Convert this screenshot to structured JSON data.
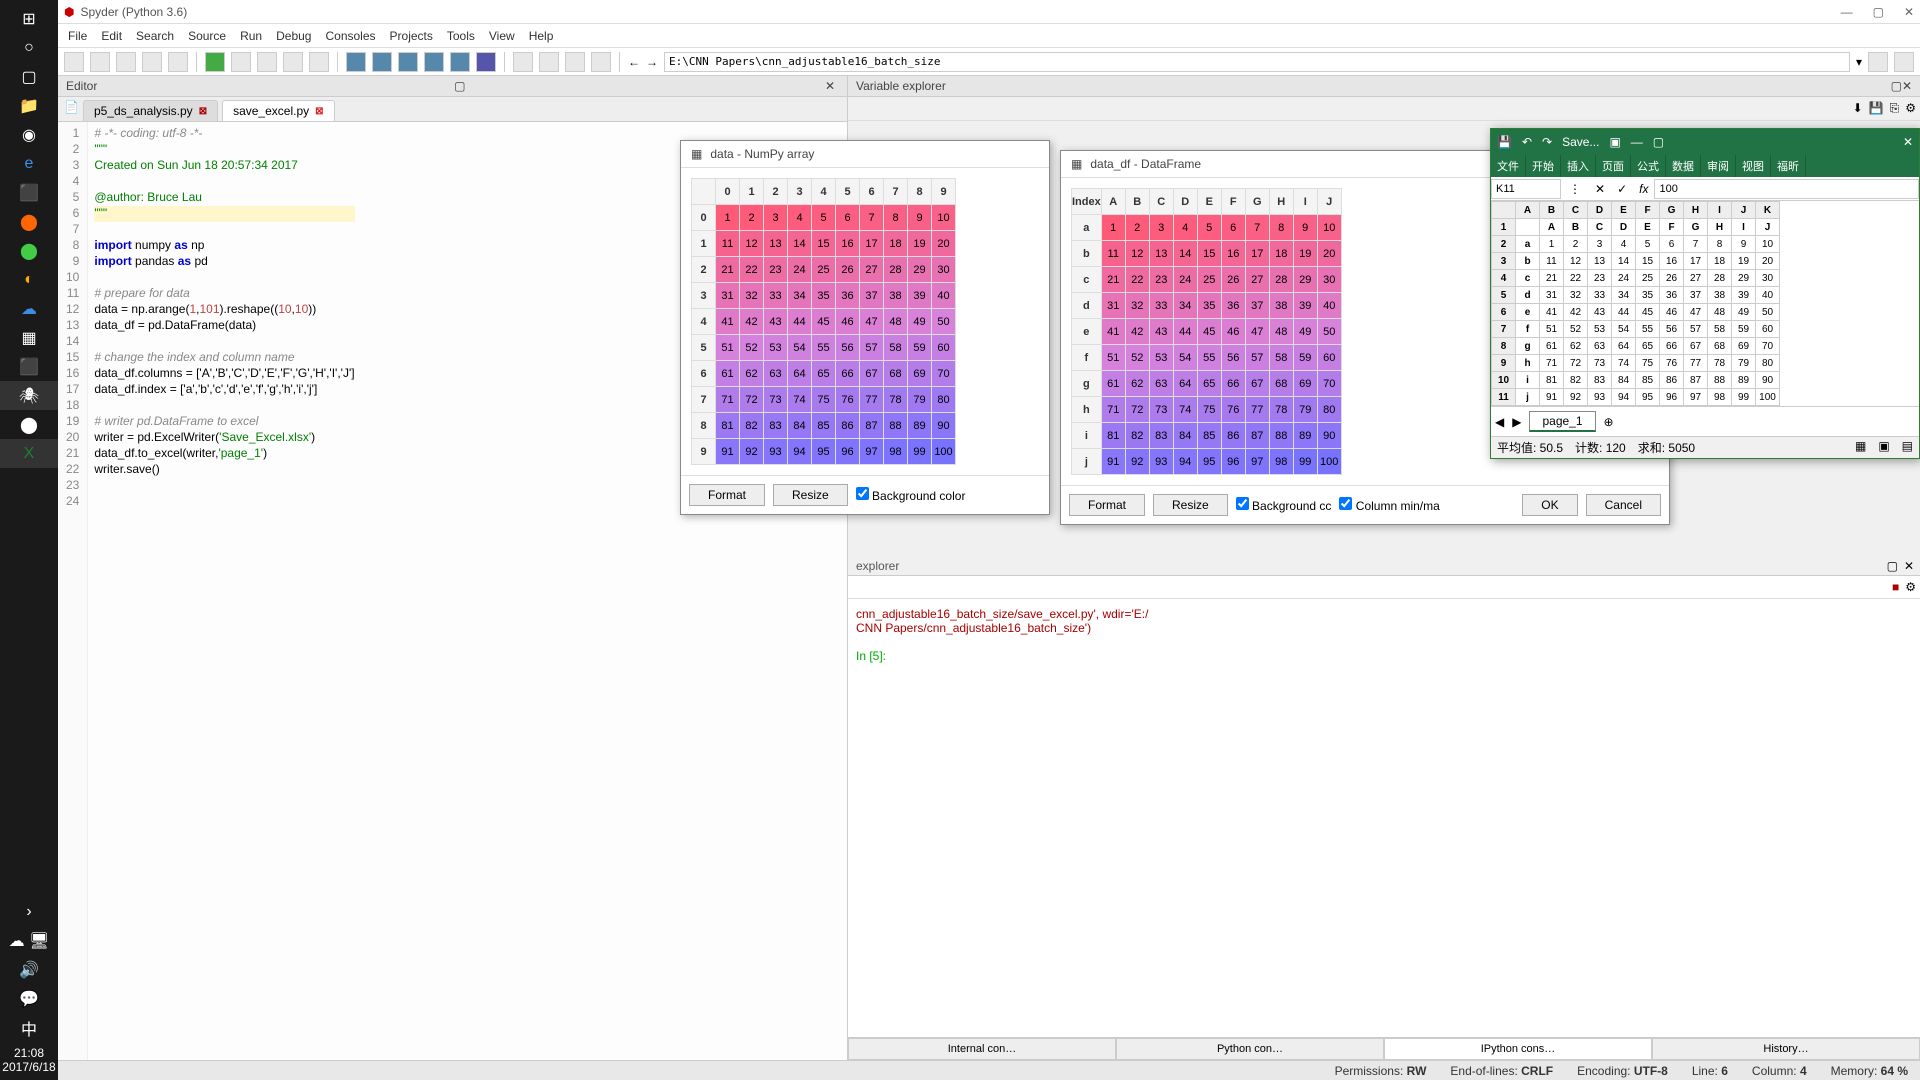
{
  "taskbar": {
    "clock_time": "21:08",
    "clock_date": "2017/6/18"
  },
  "title": "Spyder (Python 3.6)",
  "menus": [
    "File",
    "Edit",
    "Search",
    "Source",
    "Run",
    "Debug",
    "Consoles",
    "Projects",
    "Tools",
    "View",
    "Help"
  ],
  "path": "E:\\CNN Papers\\cnn_adjustable16_batch_size",
  "editor": {
    "pane": "Editor",
    "tabs": [
      {
        "label": "p5_ds_analysis.py",
        "dirty": true
      },
      {
        "label": "save_excel.py",
        "dirty": true,
        "active": true
      }
    ],
    "gutter": [
      "1",
      "2",
      "3",
      "4",
      "5",
      "6",
      "7",
      "8",
      "9",
      "10",
      "11",
      "12",
      "13",
      "14",
      "15",
      "16",
      "17",
      "18",
      "19",
      "20",
      "21",
      "22",
      "23",
      "24"
    ],
    "code": {
      "l1": "# -*- coding: utf-8 -*-",
      "l2": "\"\"\"",
      "l3": "Created on Sun Jun 18 20:57:34 2017",
      "l5": "@author: Bruce Lau",
      "l6": "\"\"\"",
      "l8a": "import",
      "l8b": " numpy ",
      "l8c": "as",
      "l8d": " np",
      "l9a": "import",
      "l9b": " pandas ",
      "l9c": "as",
      "l9d": " pd",
      "l11": "# prepare for data",
      "l12a": "data = np.arange(",
      "l12b": "1",
      "l12c": ",",
      "l12d": "101",
      "l12e": ").reshape((",
      "l12f": "10",
      "l12g": ",",
      "l12h": "10",
      "l12i": "))",
      "l13": "data_df = pd.DataFrame(data)",
      "l15": "# change the index and column name",
      "l16": "data_df.columns = ['A','B','C','D','E','F','G','H','I','J']",
      "l17": "data_df.index = ['a','b','c','d','e','f','g','h','i','j']",
      "l19": "# writer pd.DataFrame to excel",
      "l20a": "writer = pd.ExcelWriter(",
      "l20b": "'Save_Excel.xlsx'",
      "l20c": ")",
      "l21a": "data_df.to_excel(writer,",
      "l21b": "'page_1'",
      "l21c": ")",
      "l22": "writer.save()"
    }
  },
  "varexp_pane": "Variable explorer",
  "varexp_sub": "explorer",
  "viewers": {
    "numpy": {
      "title": "data - NumPy array",
      "cols": [
        "0",
        "1",
        "2",
        "3",
        "4",
        "5",
        "6",
        "7",
        "8",
        "9"
      ],
      "rows": [
        "0",
        "1",
        "2",
        "3",
        "4",
        "5",
        "6",
        "7",
        "8",
        "9"
      ],
      "format": "Format",
      "resize": "Resize",
      "bg": "Background color"
    },
    "df": {
      "title": "data_df - DataFrame",
      "index_label": "Index",
      "cols": [
        "A",
        "B",
        "C",
        "D",
        "E",
        "F",
        "G",
        "H",
        "I",
        "J"
      ],
      "rows": [
        "a",
        "b",
        "c",
        "d",
        "e",
        "f",
        "g",
        "h",
        "i",
        "j"
      ],
      "format": "Format",
      "resize": "Resize",
      "bg": "Background cc",
      "minmax": "Column min/ma",
      "ok": "OK",
      "cancel": "Cancel"
    }
  },
  "chart_data": {
    "type": "table",
    "title": "10×10 numpy array values 1..100",
    "columns": [
      "0",
      "1",
      "2",
      "3",
      "4",
      "5",
      "6",
      "7",
      "8",
      "9"
    ],
    "rows": [
      "0",
      "1",
      "2",
      "3",
      "4",
      "5",
      "6",
      "7",
      "8",
      "9"
    ],
    "data": [
      [
        1,
        2,
        3,
        4,
        5,
        6,
        7,
        8,
        9,
        10
      ],
      [
        11,
        12,
        13,
        14,
        15,
        16,
        17,
        18,
        19,
        20
      ],
      [
        21,
        22,
        23,
        24,
        25,
        26,
        27,
        28,
        29,
        30
      ],
      [
        31,
        32,
        33,
        34,
        35,
        36,
        37,
        38,
        39,
        40
      ],
      [
        41,
        42,
        43,
        44,
        45,
        46,
        47,
        48,
        49,
        50
      ],
      [
        51,
        52,
        53,
        54,
        55,
        56,
        57,
        58,
        59,
        60
      ],
      [
        61,
        62,
        63,
        64,
        65,
        66,
        67,
        68,
        69,
        70
      ],
      [
        71,
        72,
        73,
        74,
        75,
        76,
        77,
        78,
        79,
        80
      ],
      [
        81,
        82,
        83,
        84,
        85,
        86,
        87,
        88,
        89,
        90
      ],
      [
        91,
        92,
        93,
        94,
        95,
        96,
        97,
        98,
        99,
        100
      ]
    ]
  },
  "excel": {
    "save_label": "Save...",
    "ribbon": [
      "文件",
      "开始",
      "插入",
      "页面",
      "公式",
      "数据",
      "审阅",
      "视图",
      "福昕"
    ],
    "cellref": "K11",
    "fx_value": "100",
    "cols": [
      "A",
      "B",
      "C",
      "D",
      "E",
      "F",
      "G",
      "H",
      "I",
      "J",
      "K"
    ],
    "rownums": [
      "1",
      "2",
      "3",
      "4",
      "5",
      "6",
      "7",
      "8",
      "9",
      "10",
      "11"
    ],
    "header_cells": [
      "",
      "A",
      "B",
      "C",
      "D",
      "E",
      "F",
      "G",
      "H",
      "I",
      "J"
    ],
    "index_labels": [
      "a",
      "b",
      "c",
      "d",
      "e",
      "f",
      "g",
      "h",
      "i",
      "j"
    ],
    "sheet": "page_1",
    "status": {
      "avg": "平均值: 50.5",
      "cnt": "计数: 120",
      "sum": "求和: 5050"
    }
  },
  "console": {
    "line1": "cnn_adjustable16_batch_size/save_excel.py', wdir='E:/",
    "line2": "CNN Papers/cnn_adjustable16_batch_size')",
    "prompt": "In [5]:",
    "tabs": [
      "Internal con…",
      "Python con…",
      "IPython cons…",
      "History…"
    ]
  },
  "status": {
    "perm": "Permissions:",
    "perm_v": "RW",
    "eol": "End-of-lines:",
    "eol_v": "CRLF",
    "enc": "Encoding:",
    "enc_v": "UTF-8",
    "line": "Line:",
    "line_v": "6",
    "col": "Column:",
    "col_v": "4",
    "mem": "Memory:",
    "mem_v": "64 %"
  }
}
